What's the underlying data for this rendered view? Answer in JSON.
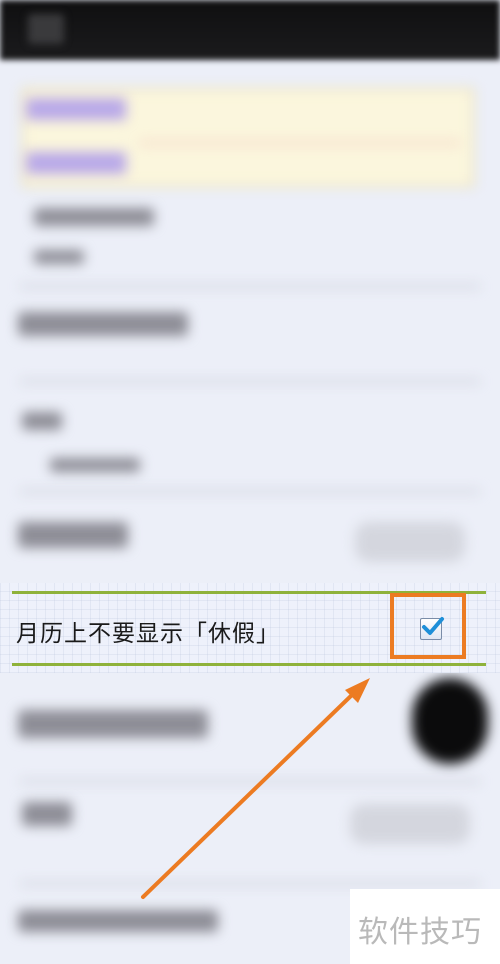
{
  "setting": {
    "label": "月历上不要显示「休假」",
    "checked": true
  },
  "watermark": {
    "text": "软件技巧"
  },
  "colors": {
    "accent_line": "#8fb23a",
    "highlight": "#ec7b22",
    "check": "#1e8fd8"
  },
  "icons": {
    "checkbox": "checkbox-checked-icon",
    "arrow": "arrow-up-right-icon"
  }
}
